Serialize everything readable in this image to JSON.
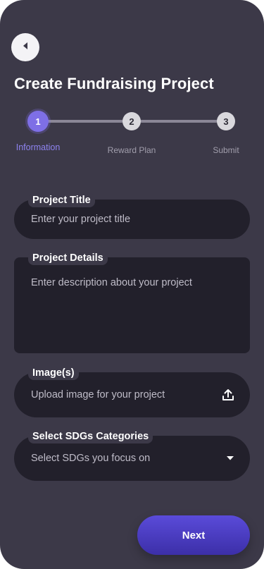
{
  "header": {
    "back_icon": "chevron-left-icon",
    "title": "Create Fundraising Project"
  },
  "stepper": {
    "steps": [
      {
        "number": "1",
        "label": "Information",
        "active": true
      },
      {
        "number": "2",
        "label": "Reward Plan",
        "active": false
      },
      {
        "number": "3",
        "label": "Submit",
        "active": false
      }
    ]
  },
  "form": {
    "project_title": {
      "label": "Project Title",
      "placeholder": "Enter your project title"
    },
    "project_details": {
      "label": "Project Details",
      "placeholder": "Enter description about your project"
    },
    "images": {
      "label": "Image(s)",
      "placeholder": "Upload image for your project",
      "icon": "upload-icon"
    },
    "sdgs": {
      "label": "Select SDGs Categories",
      "placeholder": "Select SDGs you focus on",
      "icon": "caret-down-icon"
    }
  },
  "footer": {
    "next_label": "Next"
  },
  "colors": {
    "background": "#3c3948",
    "field": "#22202b",
    "accent": "#7e6fe6",
    "button": "#4a3cc4"
  }
}
